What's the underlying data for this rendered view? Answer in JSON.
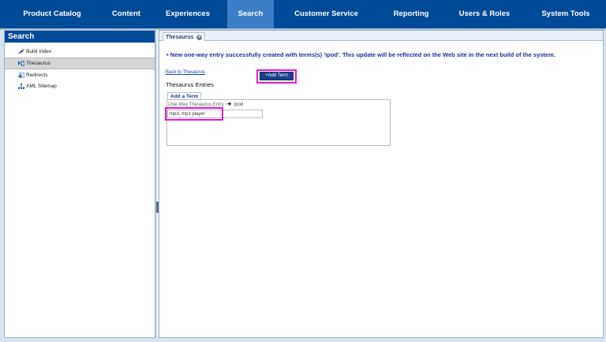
{
  "nav": {
    "items": [
      {
        "label": "Product Catalog",
        "active": false
      },
      {
        "label": "Content",
        "active": false
      },
      {
        "label": "Experiences",
        "active": false
      },
      {
        "label": "Search",
        "active": true
      },
      {
        "label": "Customer Service",
        "active": false
      },
      {
        "label": "Reporting",
        "active": false
      },
      {
        "label": "Users & Roles",
        "active": false
      },
      {
        "label": "System Tools",
        "active": false
      }
    ]
  },
  "sidebar": {
    "title": "Search",
    "items": [
      {
        "label": "Build Index",
        "icon": "build-index-icon"
      },
      {
        "label": "Thesaurus",
        "icon": "thesaurus-icon",
        "selected": true
      },
      {
        "label": "Redirects",
        "icon": "redirects-icon"
      },
      {
        "label": "XML Sitemap",
        "icon": "sitemap-icon"
      }
    ]
  },
  "tab": {
    "label": "Thesaurus"
  },
  "main": {
    "message": "New one-way entry successfully created with terms(s) 'ipod'. This update will be reflected on the Web site in the next build of the system.",
    "back_link": "Back to Thesaurus",
    "entries_heading": "Thesaurus Entries",
    "add_term_tab": "Add a Term",
    "entry_label": "One-Way Thesaurus Entry",
    "entry_term": "ipod",
    "term_input_value": "mp3, mp3 player",
    "add_term_button": "+Add Term"
  },
  "colors": {
    "nav_bg": "#004a98",
    "nav_active": "#3c7fc6",
    "highlight": "#e61bd1",
    "message": "#1f2fa0"
  }
}
